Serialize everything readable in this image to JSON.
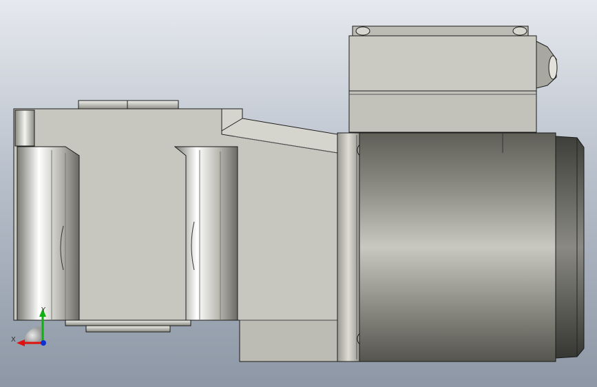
{
  "viewport": {
    "background_top": "#e6e9ee",
    "background_bottom": "#8d97a5",
    "model": "gear-motor-assembly",
    "view": "side"
  },
  "triad": {
    "x_label": "X",
    "y_label": "Y",
    "x_color": "#e01010",
    "y_color": "#10b010",
    "z_color": "#1030d0"
  }
}
